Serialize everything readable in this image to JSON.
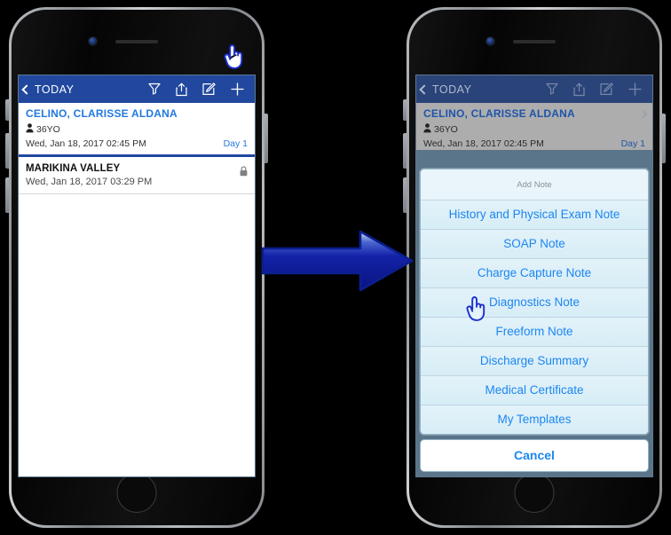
{
  "screens": {
    "left": {
      "navbar": {
        "back_label": "TODAY",
        "icons": [
          "filter-icon",
          "share-icon",
          "compose-icon",
          "add-icon"
        ]
      },
      "patient": {
        "name": "CELINO, CLARISSE  ALDANA",
        "age": "36YO",
        "datetime": "Wed, Jan 18, 2017 02:45 PM",
        "day": "Day 1"
      },
      "list": [
        {
          "title": "MARIKINA VALLEY",
          "subtitle": "Wed, Jan 18, 2017 03:29 PM",
          "badge": "lock-icon"
        }
      ]
    },
    "right": {
      "navbar": {
        "back_label": "TODAY",
        "icons": [
          "filter-icon",
          "share-icon",
          "compose-icon",
          "add-icon"
        ]
      },
      "patient": {
        "name": "CELINO, CLARISSE  ALDANA",
        "age": "36YO",
        "datetime": "Wed, Jan 18, 2017 02:45 PM",
        "day": "Day 1"
      },
      "action_sheet": {
        "title": "Add Note",
        "options": [
          "History and Physical Exam Note",
          "SOAP Note",
          "Charge Capture Note",
          "Diagnostics Note",
          "Freeform Note",
          "Discharge Summary",
          "Medical Certificate",
          "My Templates"
        ],
        "cancel_label": "Cancel"
      }
    }
  },
  "annotations": {
    "cursor_left": "hand-pointer-cursor",
    "cursor_right": "hand-pointer-cursor",
    "flow_arrow": "right-arrow"
  },
  "colors": {
    "navbar_blue": "#21489e",
    "link_blue": "#2278e0",
    "sheet_blue": "#1c86f2",
    "sheet_bg": "#dff0f7",
    "dim_overlay": "#5a7489",
    "arrow_blue": "#1a31b4"
  }
}
